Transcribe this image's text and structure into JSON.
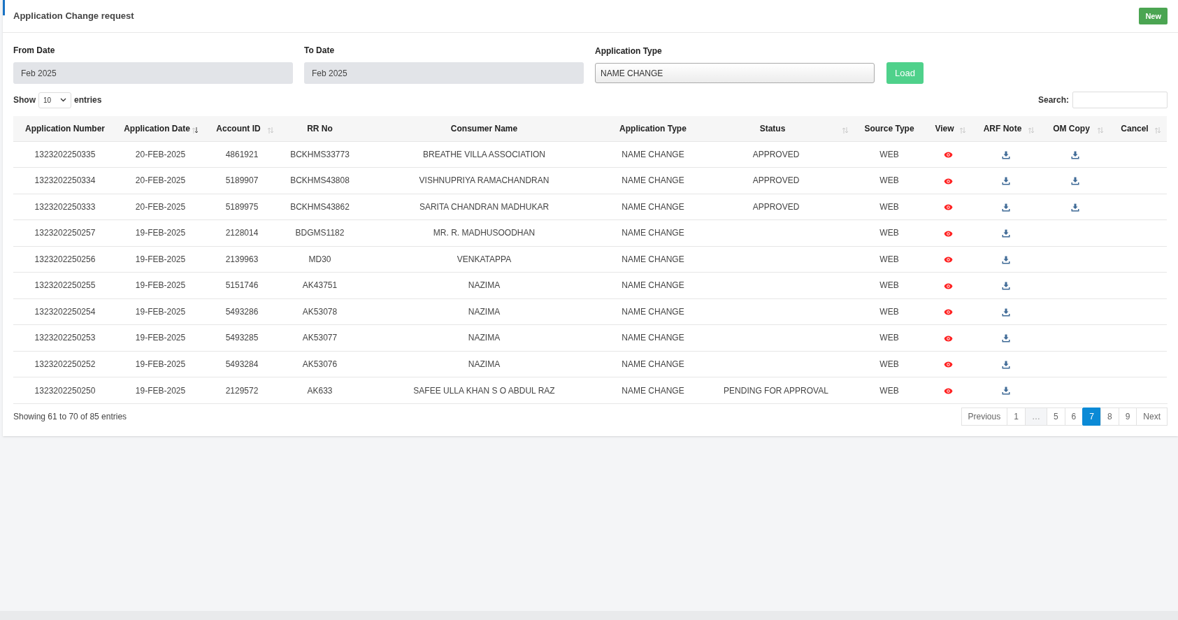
{
  "header": {
    "title": "Application Change request",
    "new_button": "New"
  },
  "filters": [
    {
      "label": "From Date",
      "value": "Feb 2025",
      "kind": "date"
    },
    {
      "label": "To Date",
      "value": "Feb 2025",
      "kind": "date"
    },
    {
      "label": "Application Type",
      "value": "NAME CHANGE",
      "kind": "select"
    }
  ],
  "load_button": "Load",
  "length": {
    "prefix": "Show",
    "value": "10",
    "suffix": "entries"
  },
  "search": {
    "label": "Search:"
  },
  "table": {
    "columns": [
      {
        "label": "Application Number",
        "sortable": false,
        "sorted": false
      },
      {
        "label": "Application Date",
        "sortable": true,
        "sorted": true
      },
      {
        "label": "Account ID",
        "sortable": true,
        "sorted": false
      },
      {
        "label": "RR No",
        "sortable": false,
        "sorted": false
      },
      {
        "label": "Consumer Name",
        "sortable": false,
        "sorted": false
      },
      {
        "label": "Application Type",
        "sortable": false,
        "sorted": false
      },
      {
        "label": "Status",
        "sortable": true,
        "sorted": false
      },
      {
        "label": "Source Type",
        "sortable": false,
        "sorted": false
      },
      {
        "label": "View",
        "sortable": true,
        "sorted": false
      },
      {
        "label": "ARF Note",
        "sortable": true,
        "sorted": false
      },
      {
        "label": "OM Copy",
        "sortable": true,
        "sorted": false
      },
      {
        "label": "Cancel",
        "sortable": true,
        "sorted": false
      }
    ],
    "rows": [
      {
        "number": "1323202250335",
        "date": "20-FEB-2025",
        "account": "4861921",
        "rr": "BCKHMS33773",
        "consumer": "BREATHE VILLA ASSOCIATION",
        "type": "NAME CHANGE",
        "status": "APPROVED",
        "source": "WEB",
        "view": true,
        "arf_note": true,
        "om_copy": true
      },
      {
        "number": "1323202250334",
        "date": "20-FEB-2025",
        "account": "5189907",
        "rr": "BCKHMS43808",
        "consumer": "VISHNUPRIYA RAMACHANDRAN",
        "type": "NAME CHANGE",
        "status": "APPROVED",
        "source": "WEB",
        "view": true,
        "arf_note": true,
        "om_copy": true
      },
      {
        "number": "1323202250333",
        "date": "20-FEB-2025",
        "account": "5189975",
        "rr": "BCKHMS43862",
        "consumer": "SARITA CHANDRAN MADHUKAR",
        "type": "NAME CHANGE",
        "status": "APPROVED",
        "source": "WEB",
        "view": true,
        "arf_note": true,
        "om_copy": true
      },
      {
        "number": "1323202250257",
        "date": "19-FEB-2025",
        "account": "2128014",
        "rr": "BDGMS1182",
        "consumer": "MR. R. MADHUSOODHAN",
        "type": "NAME CHANGE",
        "source": "WEB",
        "view": true,
        "arf_note": true,
        "om_copy": false
      },
      {
        "number": "1323202250256",
        "date": "19-FEB-2025",
        "account": "2139963",
        "rr": "MD30",
        "consumer": "VENKATAPPA",
        "type": "NAME CHANGE",
        "source": "WEB",
        "view": true,
        "arf_note": true,
        "om_copy": false
      },
      {
        "number": "1323202250255",
        "date": "19-FEB-2025",
        "account": "5151746",
        "rr": "AK43751",
        "consumer": "NAZIMA",
        "type": "NAME CHANGE",
        "source": "WEB",
        "view": true,
        "arf_note": true,
        "om_copy": false
      },
      {
        "number": "1323202250254",
        "date": "19-FEB-2025",
        "account": "5493286",
        "rr": "AK53078",
        "consumer": "NAZIMA",
        "type": "NAME CHANGE",
        "source": "WEB",
        "view": true,
        "arf_note": true,
        "om_copy": false
      },
      {
        "number": "1323202250253",
        "date": "19-FEB-2025",
        "account": "5493285",
        "rr": "AK53077",
        "consumer": "NAZIMA",
        "type": "NAME CHANGE",
        "source": "WEB",
        "view": true,
        "arf_note": true,
        "om_copy": false
      },
      {
        "number": "1323202250252",
        "date": "19-FEB-2025",
        "account": "5493284",
        "rr": "AK53076",
        "consumer": "NAZIMA",
        "type": "NAME CHANGE",
        "source": "WEB",
        "view": true,
        "arf_note": true,
        "om_copy": false
      },
      {
        "number": "1323202250250",
        "date": "19-FEB-2025",
        "account": "2129572",
        "rr": "AK633",
        "consumer": "SAFEE ULLA KHAN S O ABDUL RAZ",
        "type": "NAME CHANGE",
        "status": "PENDING FOR APPROVAL",
        "source": "WEB",
        "view": true,
        "arf_note": true,
        "om_copy": false
      }
    ]
  },
  "info": "Showing 61 to 70 of 85 entries",
  "pagination": [
    {
      "label": "Previous",
      "selected": false,
      "disabled": false
    },
    {
      "label": "1",
      "selected": false,
      "disabled": false
    },
    {
      "label": "…",
      "selected": false,
      "disabled": true
    },
    {
      "label": "5",
      "selected": false,
      "disabled": false
    },
    {
      "label": "6",
      "selected": false,
      "disabled": false
    },
    {
      "label": "7",
      "selected": true,
      "disabled": false
    },
    {
      "label": "8",
      "selected": false,
      "disabled": false
    },
    {
      "label": "9",
      "selected": false,
      "disabled": false
    },
    {
      "label": "Next",
      "selected": false,
      "disabled": false
    }
  ]
}
